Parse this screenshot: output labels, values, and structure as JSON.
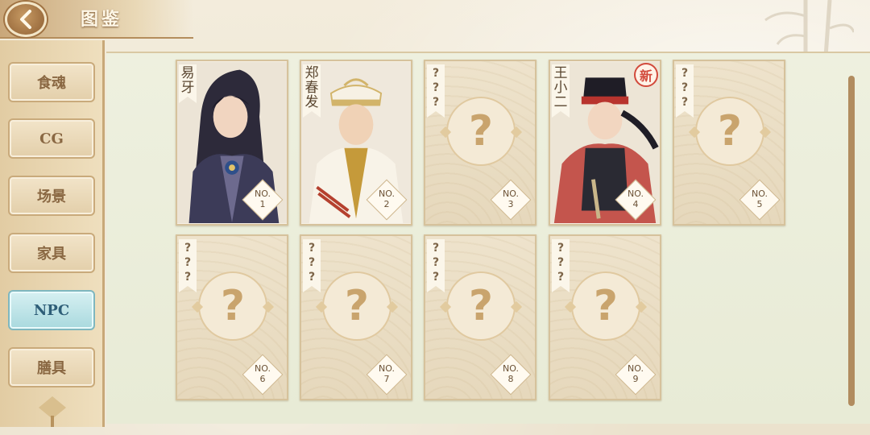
{
  "header": {
    "title": "图鉴"
  },
  "sidebar": {
    "items": [
      {
        "label": "食魂",
        "active": false
      },
      {
        "label": "CG",
        "active": false
      },
      {
        "label": "场景",
        "active": false
      },
      {
        "label": "家具",
        "active": false
      },
      {
        "label": "NPC",
        "active": true
      },
      {
        "label": "膳具",
        "active": false
      }
    ]
  },
  "cards": [
    {
      "name": "易牙",
      "no_label": "NO.",
      "no_num": "1",
      "known": true
    },
    {
      "name": "郑春发",
      "no_label": "NO.",
      "no_num": "2",
      "known": true
    },
    {
      "name": "???",
      "no_label": "NO.",
      "no_num": "3",
      "known": false,
      "question": "?"
    },
    {
      "name": "王小二",
      "no_label": "NO.",
      "no_num": "4",
      "known": true,
      "new_badge": "新"
    },
    {
      "name": "???",
      "no_label": "NO.",
      "no_num": "5",
      "known": false,
      "question": "?"
    },
    {
      "name": "???",
      "no_label": "NO.",
      "no_num": "6",
      "known": false,
      "question": "?"
    },
    {
      "name": "???",
      "no_label": "NO.",
      "no_num": "7",
      "known": false,
      "question": "?"
    },
    {
      "name": "???",
      "no_label": "NO.",
      "no_num": "8",
      "known": false,
      "question": "?"
    },
    {
      "name": "???",
      "no_label": "NO.",
      "no_num": "9",
      "known": false,
      "question": "?"
    }
  ],
  "icons": {
    "back": "chevron-left-icon",
    "question": "question-mark-icon",
    "new": "new-badge-icon"
  },
  "colors": {
    "accent_brown": "#b18c5f",
    "active_tab": "#a9d9de",
    "new_badge": "#d24a3c"
  }
}
